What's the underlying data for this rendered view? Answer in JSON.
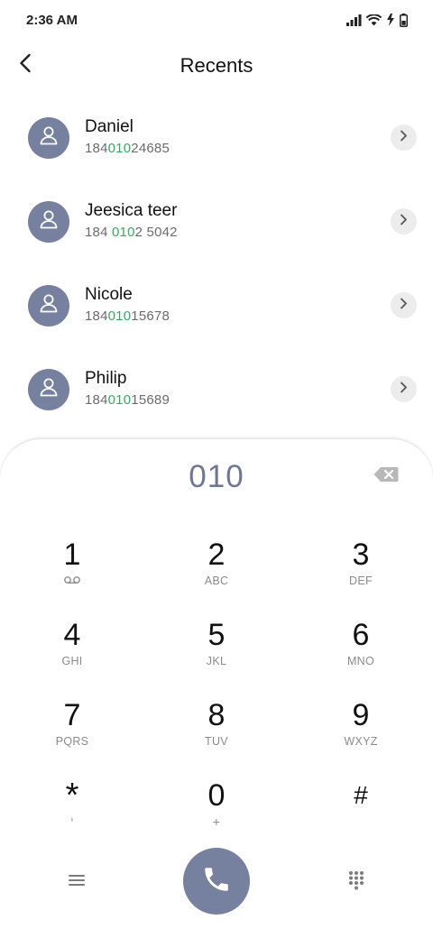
{
  "status": {
    "time": "2:36 AM"
  },
  "header": {
    "title": "Recents"
  },
  "recents": [
    {
      "name": "Daniel",
      "number_parts": [
        "184",
        "010",
        "24685"
      ]
    },
    {
      "name": "Jeesica teer",
      "number_parts": [
        "184 ",
        "010",
        "2 5042"
      ]
    },
    {
      "name": "Nicole",
      "number_parts": [
        "184",
        "010",
        "15678"
      ]
    },
    {
      "name": "Philip",
      "number_parts": [
        "184",
        "010",
        "15689"
      ]
    }
  ],
  "dialpad": {
    "entered": "010",
    "keys": [
      {
        "digit": "1",
        "letters": ""
      },
      {
        "digit": "2",
        "letters": "ABC"
      },
      {
        "digit": "3",
        "letters": "DEF"
      },
      {
        "digit": "4",
        "letters": "GHI"
      },
      {
        "digit": "5",
        "letters": "JKL"
      },
      {
        "digit": "6",
        "letters": "MNO"
      },
      {
        "digit": "7",
        "letters": "PQRS"
      },
      {
        "digit": "8",
        "letters": "TUV"
      },
      {
        "digit": "9",
        "letters": "WXYZ"
      },
      {
        "digit": "*",
        "letters": ","
      },
      {
        "digit": "0",
        "letters": "+"
      },
      {
        "digit": "#",
        "letters": ""
      }
    ]
  },
  "colors": {
    "accent": "#76809f",
    "match_highlight": "#2eae5f"
  }
}
